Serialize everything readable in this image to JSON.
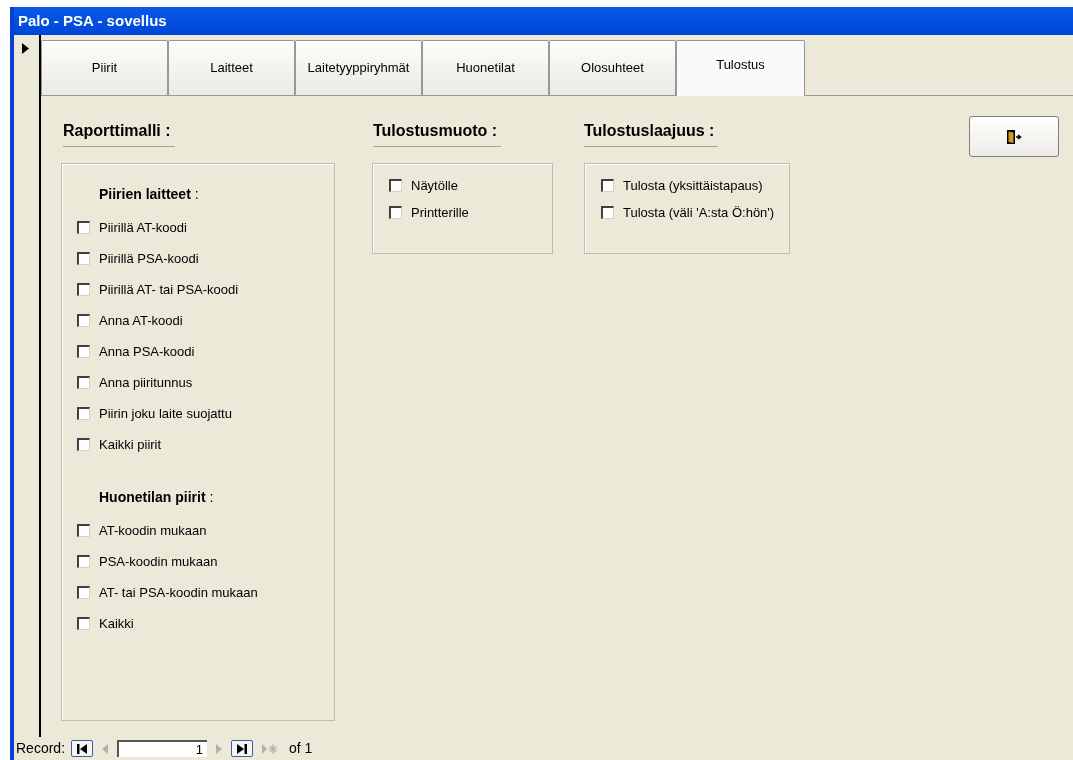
{
  "window": {
    "title": "Palo - PSA - sovellus"
  },
  "tabs": [
    {
      "label": "Piirit",
      "selected": false
    },
    {
      "label": "Laitteet",
      "selected": false
    },
    {
      "label": "Laitetyyppiryhmät",
      "selected": false
    },
    {
      "label": "Huonetilat",
      "selected": false
    },
    {
      "label": "Olosuhteet",
      "selected": false
    },
    {
      "label": "Tulostus",
      "selected": true
    }
  ],
  "report_model": {
    "heading": "Raporttimalli :",
    "groups": [
      {
        "heading": "**Piirien laitteet** :",
        "options": [
          {
            "label": "Piirillä AT-koodi",
            "checked": false
          },
          {
            "label": "Piirillä PSA-koodi",
            "checked": false
          },
          {
            "label": "Piirillä AT- tai PSA-koodi",
            "checked": false
          },
          {
            "label": "Anna AT-koodi",
            "checked": false
          },
          {
            "label": "Anna PSA-koodi",
            "checked": false
          },
          {
            "label": "Anna piiritunnus",
            "checked": false
          },
          {
            "label": "Piirin joku laite suojattu",
            "checked": false
          },
          {
            "label": "Kaikki piirit",
            "checked": false
          }
        ]
      },
      {
        "heading": "**Huonetilan piirit** :",
        "options": [
          {
            "label": "AT-koodin mukaan",
            "checked": false
          },
          {
            "label": "PSA-koodin mukaan",
            "checked": false
          },
          {
            "label": "AT- tai PSA-koodin mukaan",
            "checked": false
          },
          {
            "label": "Kaikki",
            "checked": false
          }
        ]
      }
    ]
  },
  "output_format": {
    "heading": "Tulostusmuoto :",
    "options": [
      {
        "label": "Näytölle",
        "checked": false
      },
      {
        "label": "Printterille",
        "checked": false
      }
    ]
  },
  "output_scope": {
    "heading": "Tulostuslaajuus :",
    "options": [
      {
        "label": "Tulosta (yksittäistapaus)",
        "checked": false
      },
      {
        "label": "Tulosta (väli 'A:sta Ö:hön')",
        "checked": false
      }
    ]
  },
  "navigation": {
    "label": "Record:",
    "value": "1",
    "total": "of 1",
    "buttons": [
      {
        "kind": "first",
        "disabled": false
      },
      {
        "kind": "prev",
        "disabled": true
      },
      {
        "kind": "next",
        "disabled": true
      },
      {
        "kind": "last",
        "disabled": false
      },
      {
        "kind": "new",
        "disabled": true
      }
    ]
  }
}
